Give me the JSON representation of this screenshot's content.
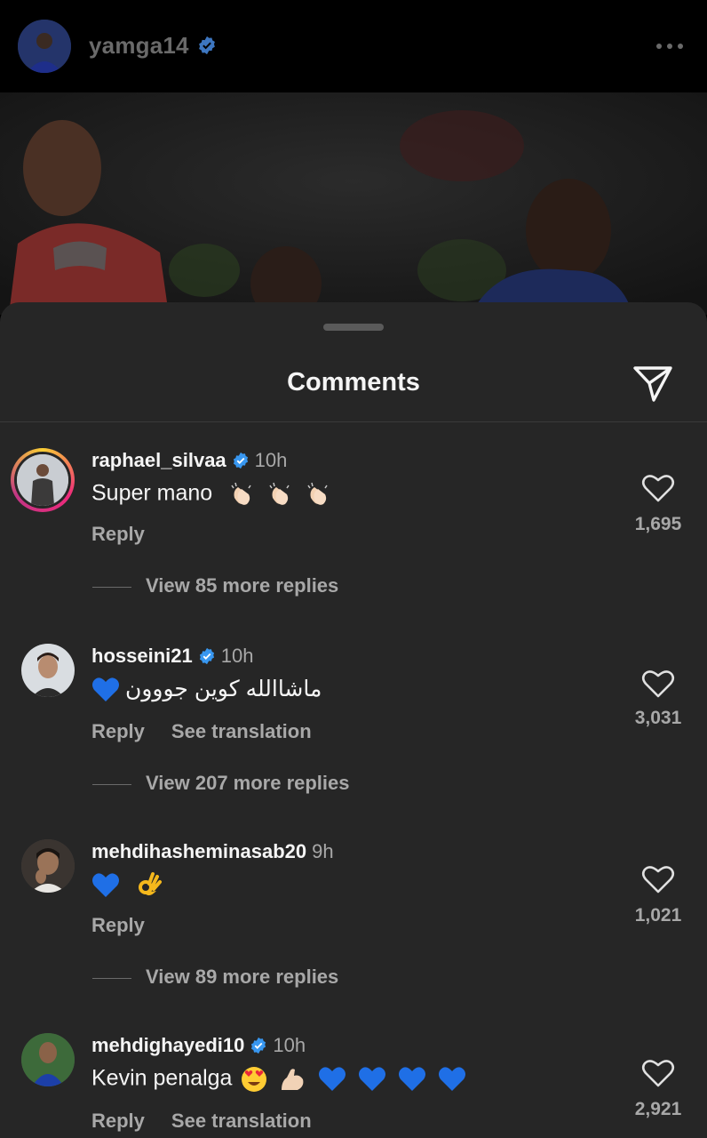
{
  "post": {
    "username": "yamga14",
    "verified": true,
    "more_icon": "more-horizontal-icon"
  },
  "sheet": {
    "title": "Comments",
    "share_icon": "paper-plane-icon"
  },
  "comments": [
    {
      "username": "raphael_silvaa",
      "verified": true,
      "time": "10h",
      "text": "Super mano",
      "emojis": [
        "clapping-hands",
        "clapping-hands",
        "clapping-hands"
      ],
      "reply_label": "Reply",
      "likes": "1,695",
      "view_replies": "View 85 more replies",
      "has_story_ring": true
    },
    {
      "username": "hosseini21",
      "verified": true,
      "time": "10h",
      "text": "ماشاالله کوین جووون",
      "emojis": [
        "blue-heart"
      ],
      "reply_label": "Reply",
      "translation_label": "See translation",
      "likes": "3,031",
      "view_replies": "View 207 more replies"
    },
    {
      "username": "mehdihasheminasab20",
      "verified": false,
      "time": "9h",
      "text": "",
      "emojis": [
        "blue-heart",
        "ok-hand"
      ],
      "reply_label": "Reply",
      "likes": "1,021",
      "view_replies": "View 89 more replies"
    },
    {
      "username": "mehdighayedi10",
      "verified": true,
      "time": "10h",
      "text": "Kevin penalga",
      "emojis": [
        "heart-eyes",
        "flexed-biceps",
        "blue-heart",
        "blue-heart",
        "blue-heart",
        "blue-heart"
      ],
      "reply_label": "Reply",
      "translation_label": "See translation",
      "likes": "2,921"
    }
  ],
  "colors": {
    "sheet_bg": "#262626",
    "muted_text": "#a8a8a8",
    "verified_blue": "#3897f0"
  }
}
